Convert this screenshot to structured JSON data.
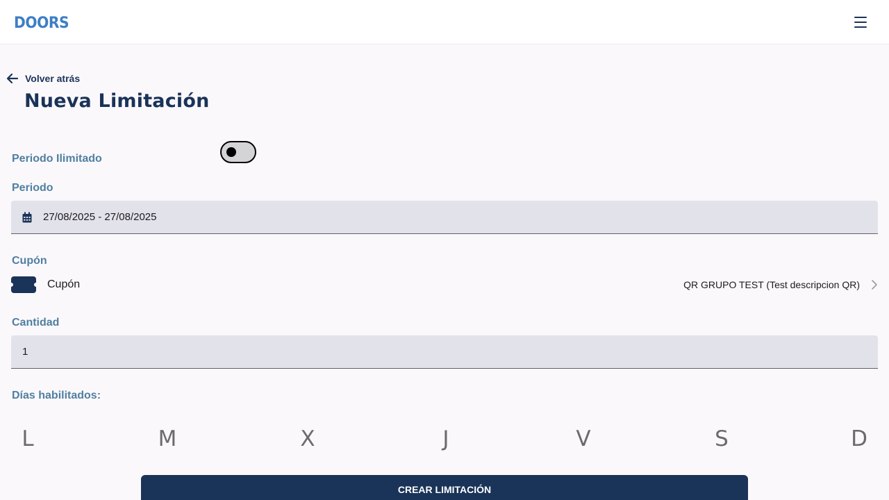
{
  "header": {
    "logo_text": "DOORS",
    "menu_icon": "hamburger-menu-icon",
    "brand_color": "#3d7fc4"
  },
  "nav": {
    "back_label": "Volver atrás",
    "back_icon": "arrow-left-icon"
  },
  "page": {
    "title": "Nueva Limitación"
  },
  "form": {
    "unlimited_label": "Periodo Ilimitado",
    "unlimited_on": false,
    "period_label": "Periodo",
    "period_icon": "calendar-icon",
    "period_value": "27/08/2025 - 27/08/2025",
    "coupon_section_label": "Cupón",
    "coupon_icon": "ticket-icon",
    "coupon_name": "Cupón",
    "coupon_value": "QR GRUPO TEST (Test descripcion QR)",
    "quantity_label": "Cantidad",
    "quantity_value": "1",
    "days_label": "Días habilitados:",
    "days": [
      "L",
      "M",
      "X",
      "J",
      "V",
      "S",
      "D"
    ]
  },
  "actions": {
    "create_label": "CREAR LIMITACIÓN",
    "primary_color": "#1a3358"
  }
}
